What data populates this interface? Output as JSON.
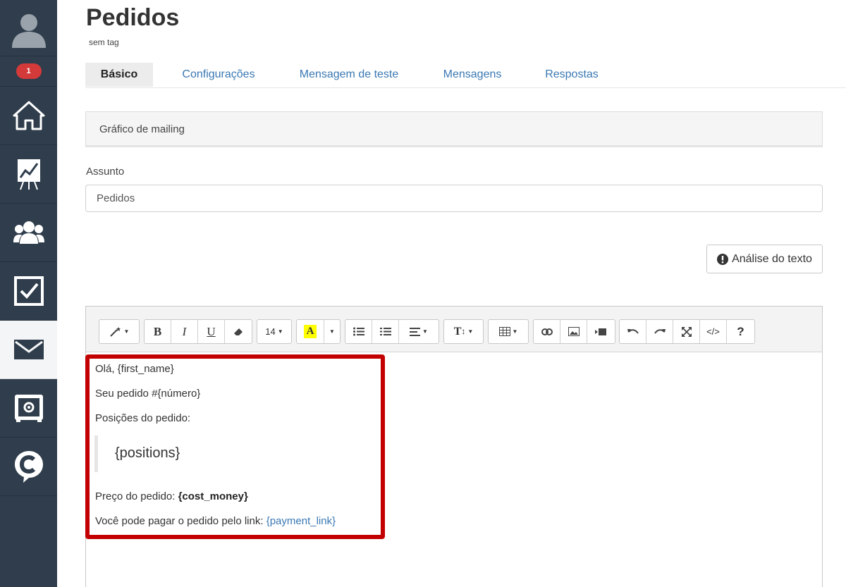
{
  "sidebar": {
    "badge_count": "1",
    "items": [
      {
        "name": "avatar",
        "icon": "user-silhouette-icon"
      },
      {
        "name": "home",
        "icon": "home-icon"
      },
      {
        "name": "statistics",
        "icon": "chart-board-icon"
      },
      {
        "name": "contacts",
        "icon": "users-group-icon"
      },
      {
        "name": "tasks",
        "icon": "checkbox-icon"
      },
      {
        "name": "mailings",
        "icon": "envelope-icon",
        "active": true
      },
      {
        "name": "settings",
        "icon": "gear-box-icon"
      },
      {
        "name": "chat",
        "icon": "chat-c-icon"
      }
    ],
    "bg_color": "#2f3d4c"
  },
  "header": {
    "title": "Pedidos",
    "subtitle": "sem tag"
  },
  "tabs": [
    {
      "label": "Básico",
      "active": true
    },
    {
      "label": "Configurações"
    },
    {
      "label": "Mensagem de teste"
    },
    {
      "label": "Mensagens"
    },
    {
      "label": "Respostas"
    }
  ],
  "panel": {
    "title": "Gráfico de mailing"
  },
  "subject": {
    "label": "Assunto",
    "value": "Pedidos"
  },
  "analyze_button": {
    "label": "Análise do texto"
  },
  "toolbar": {
    "font_size": "14",
    "text_style_label": "T"
  },
  "content": {
    "greeting": "Olá, {first_name}",
    "order_line": "Seu pedido #{número}",
    "positions_label": "Posições do pedido:",
    "positions_var": "{positions}",
    "price_label": "Preço do pedido: ",
    "price_var": "{cost_money}",
    "pay_label": "Você pode pagar o pedido pelo link: ",
    "pay_var": "{payment_link}"
  },
  "colors": {
    "accent": "#3a78b3",
    "highlight": "#c20000",
    "badge": "#d43a3a"
  }
}
